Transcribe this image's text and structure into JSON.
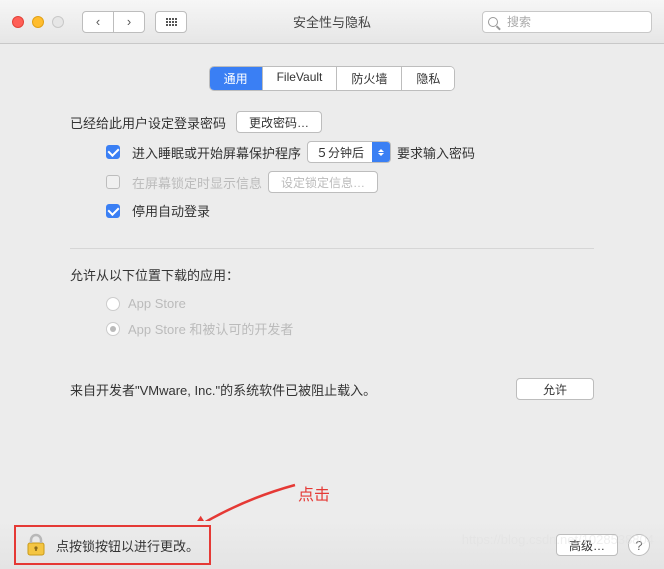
{
  "titlebar": {
    "window_title": "安全性与隐私",
    "search_placeholder": "搜索"
  },
  "tabs": {
    "general": "通用",
    "filevault": "FileVault",
    "firewall": "防火墙",
    "privacy": "隐私"
  },
  "pw_section": {
    "set_text": "已经给此用户设定登录密码",
    "change_btn": "更改密码…",
    "sleep_label": "进入睡眠或开始屏幕保护程序",
    "sleep_select": "５分钟后",
    "sleep_suffix": "要求输入密码",
    "lockmsg_label": "在屏幕锁定时显示信息",
    "lockmsg_btn": "设定锁定信息…",
    "autologin_label": "停用自动登录"
  },
  "download_section": {
    "heading": "允许从以下位置下载的应用：",
    "opt_appstore": "App Store",
    "opt_devs": "App Store 和被认可的开发者"
  },
  "blocked": {
    "text": "来自开发者\"VMware, Inc.\"的系统软件已被阻止载入。",
    "allow_btn": "允许"
  },
  "bottom": {
    "lock_text": "点按锁按钮以进行更改。",
    "advanced_btn": "高级…",
    "help": "?"
  },
  "annotation": {
    "click_label": "点击"
  },
  "watermark": "https://blog.csdn.net/1028538804"
}
